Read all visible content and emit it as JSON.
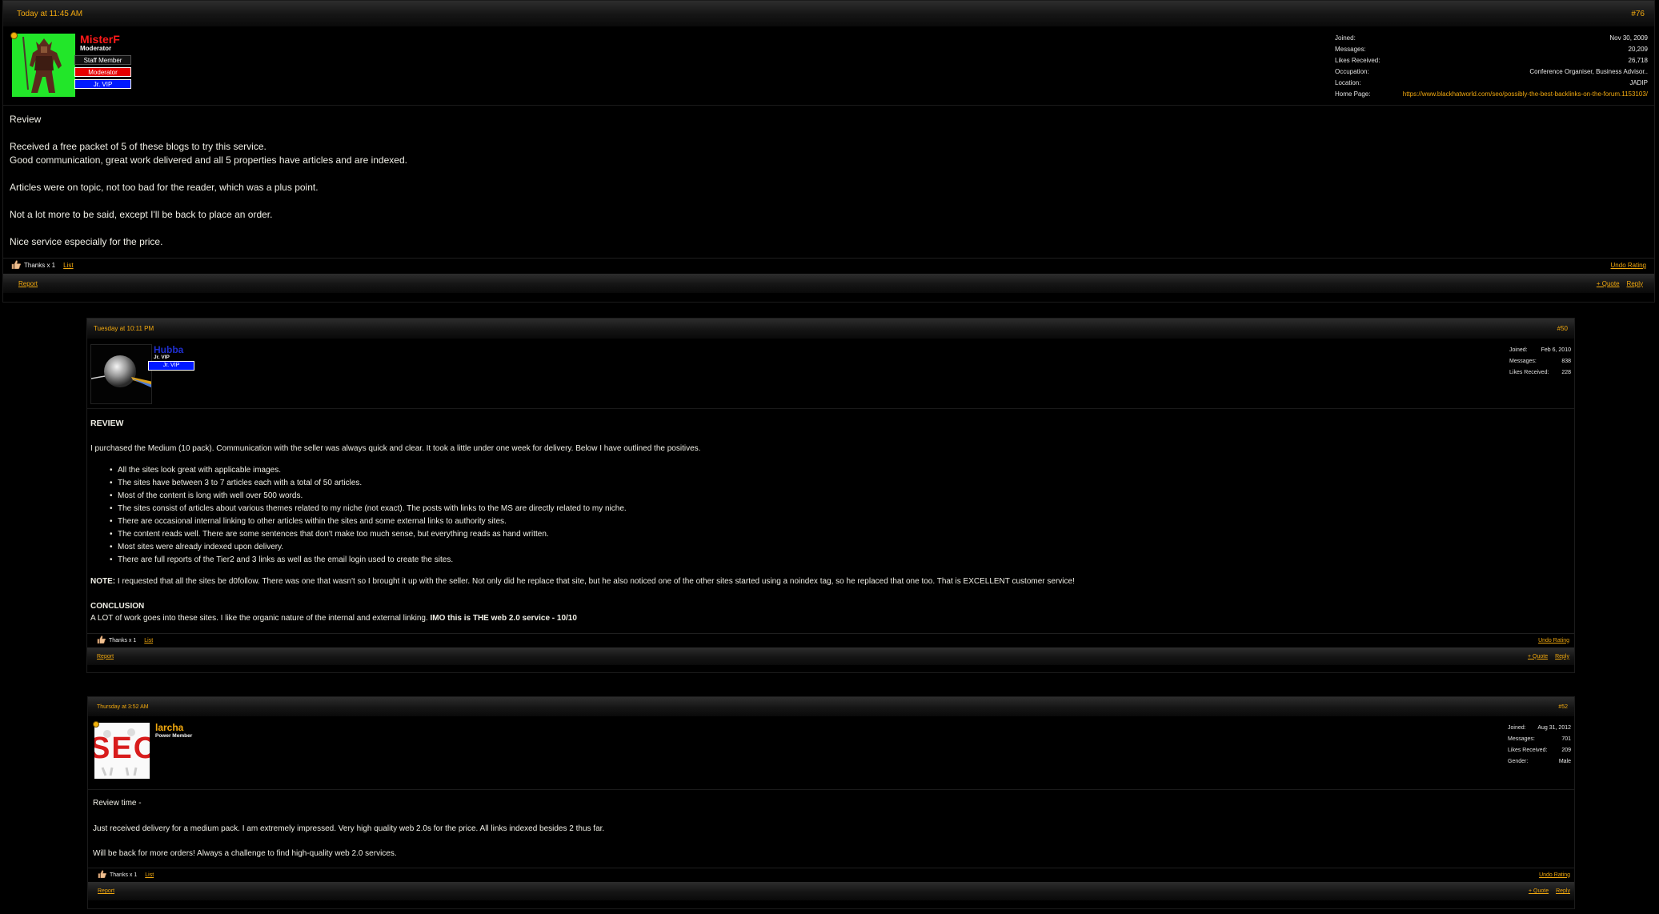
{
  "posts": [
    {
      "date": "Today at 11:45 AM",
      "number": "#76",
      "username": "MisterF",
      "user_title": "Moderator",
      "badges": [
        "Staff Member",
        "Moderator",
        "Jr. VIP"
      ],
      "stats": {
        "joined_label": "Joined:",
        "joined": "Nov 30, 2009",
        "messages_label": "Messages:",
        "messages": "20,209",
        "likes_label": "Likes Received:",
        "likes": "26,718",
        "occupation_label": "Occupation:",
        "occupation": "Conference Organiser, Business Advisor..",
        "location_label": "Location:",
        "location": "JADIP",
        "homepage_label": "Home Page:",
        "homepage": "https://www.blackhatworld.com/seo/possibly-the-best-backlinks-on-the-forum.1153103/"
      },
      "body": [
        "Review",
        "Received a free packet of 5 of these blogs to try this service.",
        "Good communication, great work delivered and all 5 properties have articles and are indexed.",
        "Articles were on topic, not too bad for the reader, which was a plus point.",
        "Not a lot more to be said, except I'll be back to place an order.",
        "Nice service especially for the price."
      ],
      "thanks": "Thanks x 1",
      "list": "List",
      "undo": "Undo Rating",
      "report": "Report",
      "quote": "+ Quote",
      "reply": "Reply"
    },
    {
      "date": "Tuesday at 10:11 PM",
      "number": "#50",
      "username": "Hubba",
      "user_title": "Jr. VIP",
      "badges": [
        "Jr. VIP"
      ],
      "stats": {
        "joined_label": "Joined:",
        "joined": "Feb 6, 2010",
        "messages_label": "Messages:",
        "messages": "838",
        "likes_label": "Likes Received:",
        "likes": "228"
      },
      "heading": "REVIEW",
      "intro": "I purchased the Medium (10 pack). Communication with the seller was always quick and clear. It took a little under one week for delivery. Below I have outlined the positives.",
      "bullets": [
        "All the sites look great with applicable images.",
        "The sites have between 3 to 7 articles each with a total of 50 articles.",
        "Most of the content is long with well over 500 words.",
        "The sites consist of articles about various themes related to my niche (not exact). The posts with links to the MS are directly related to my niche.",
        "There are occasional internal linking to other articles within the sites and some external links to authority sites.",
        "The content reads well. There are some sentences that don't make too much sense, but everything reads as hand written.",
        "Most sites were already indexed upon delivery.",
        "There are full reports of the Tier2 and 3 links as well as the email login used to create the sites."
      ],
      "note_label": "NOTE:",
      "note": " I requested that all the sites be d0follow. There was one that wasn't so I brought it up with the seller. Not only did he replace that site, but he also noticed one of the other sites started using a noindex tag, so he replaced that one too. That is EXCELLENT customer service!",
      "conclusion_heading": "CONCLUSION",
      "conclusion": "A LOT of work goes into these sites. I like the organic nature of the internal and external linking. ",
      "conclusion_bold": "IMO this is THE web 2.0 service - 10/10",
      "thanks": "Thanks x 1",
      "list": "List",
      "undo": "Undo Rating",
      "report": "Report",
      "quote": "+ Quote",
      "reply": "Reply"
    },
    {
      "date": "Thursday at 3:52 AM",
      "number": "#52",
      "username": "larcha",
      "user_title": "Power Member",
      "avatar_text": "SEO",
      "stats": {
        "joined_label": "Joined:",
        "joined": "Aug 31, 2012",
        "messages_label": "Messages:",
        "messages": "701",
        "likes_label": "Likes Received:",
        "likes": "209",
        "gender_label": "Gender:",
        "gender": "Male"
      },
      "body": [
        "Review time -",
        "Just received delivery for a medium pack. I am extremely impressed. Very high quality web 2.0s for the price. All links indexed besides 2 thus far.",
        "Will be back for more orders! Always a challenge to find high-quality web 2.0 services."
      ],
      "thanks": "Thanks x 1",
      "list": "List",
      "undo": "Undo Rating",
      "report": "Report",
      "quote": "+ Quote",
      "reply": "Reply"
    }
  ]
}
